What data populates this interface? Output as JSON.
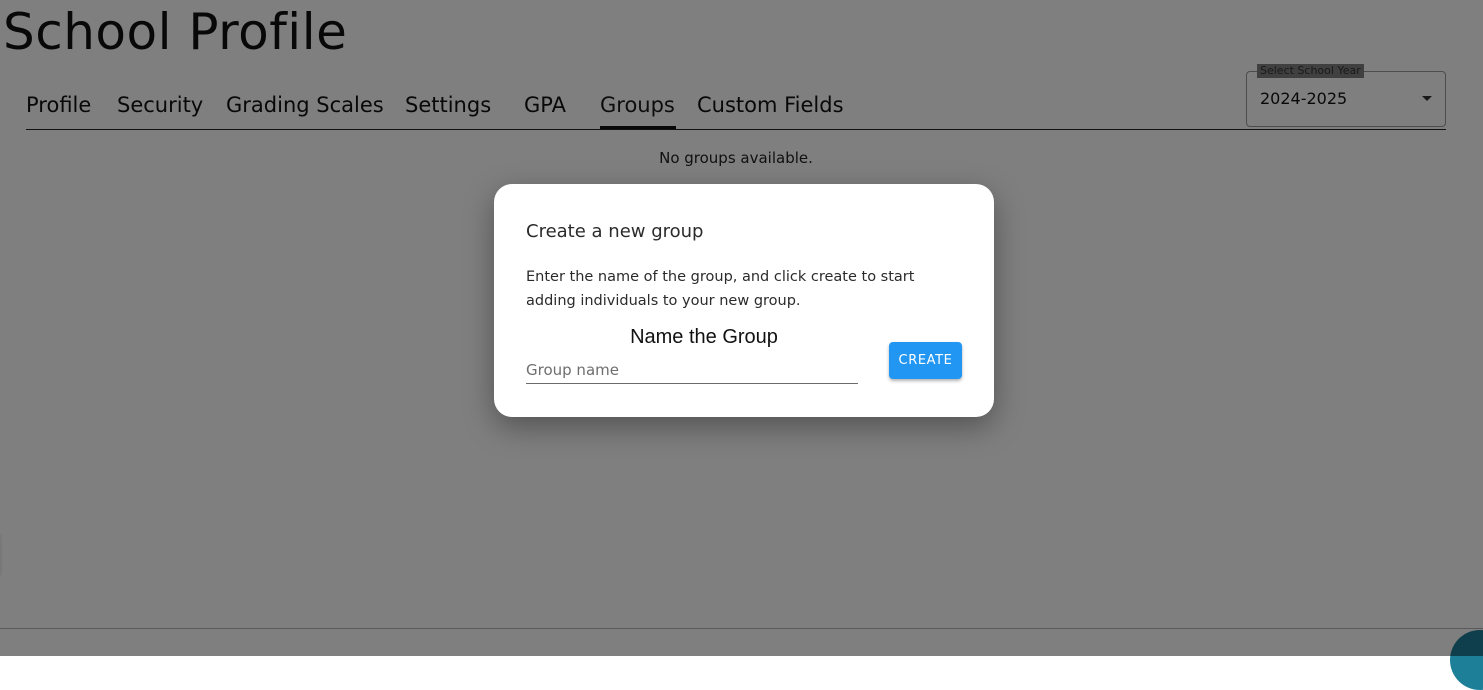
{
  "page": {
    "title": "School Profile",
    "empty_message": "No groups available."
  },
  "tabs": [
    {
      "label": "Profile"
    },
    {
      "label": "Security"
    },
    {
      "label": "Grading Scales"
    },
    {
      "label": "Settings"
    },
    {
      "label": "GPA"
    },
    {
      "label": "Groups",
      "active": true
    },
    {
      "label": "Custom Fields"
    }
  ],
  "year_select": {
    "label": "Select School Year",
    "value": "2024-2025",
    "icon": "caret-down-icon"
  },
  "dialog": {
    "title": "Create a new group",
    "description": "Enter the name of the group, and click create to start adding individuals to your new group.",
    "field_heading": "Name the Group",
    "input_value": "",
    "input_placeholder": "Group name",
    "create_label": "CREATE"
  },
  "colors": {
    "accent": "#2196f3",
    "overlay": "#808080",
    "chat": "#1e7f99"
  }
}
